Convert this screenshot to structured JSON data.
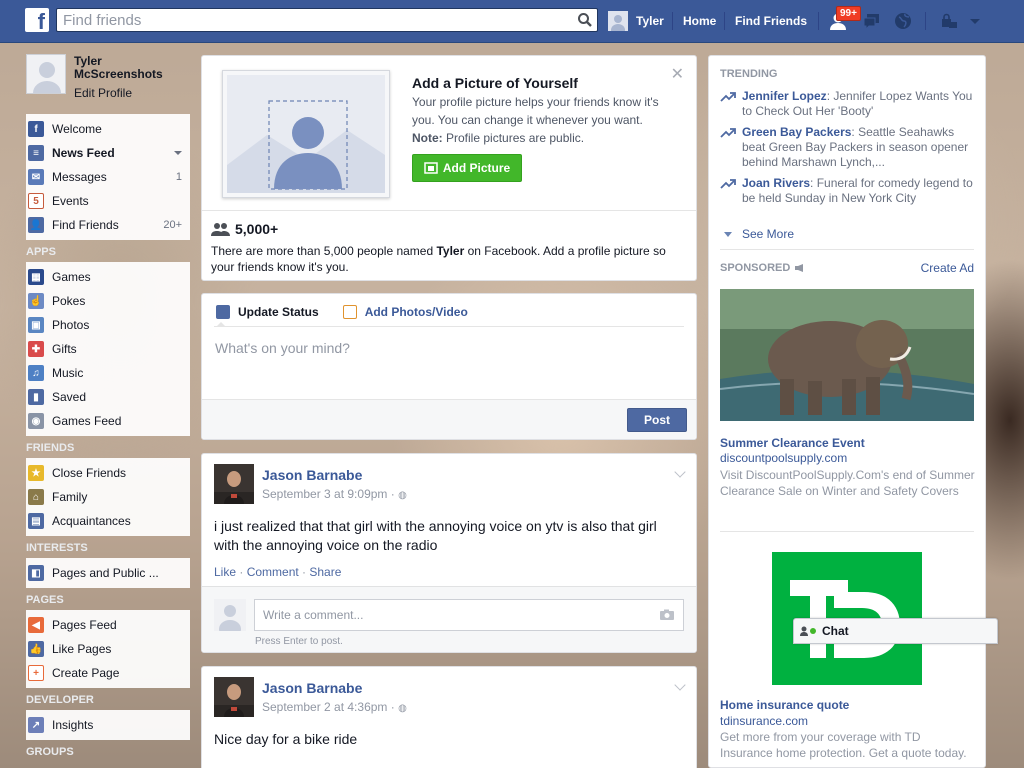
{
  "topbar": {
    "search_placeholder": "Find friends",
    "user_name": "Tyler",
    "home": "Home",
    "find_friends": "Find Friends",
    "friend_requests_badge": "99+",
    "icons": [
      "friend-requests-icon",
      "messages-icon",
      "notifications-globe-icon",
      "privacy-icon",
      "account-menu-icon"
    ]
  },
  "profile": {
    "name": "Tyler McScreenshots",
    "edit": "Edit Profile"
  },
  "nav": {
    "main": [
      {
        "label": "Welcome",
        "count": "",
        "icon": "facebook-icon",
        "color": "#3b5998"
      },
      {
        "label": "News Feed",
        "count": "",
        "icon": "news-feed-icon",
        "color": "#4e69a2"
      },
      {
        "label": "Messages",
        "count": "1",
        "icon": "messages-icon",
        "color": "#5a7ab8"
      },
      {
        "label": "Events",
        "count": "",
        "icon": "events-icon",
        "color": "#c65b3d"
      },
      {
        "label": "Find Friends",
        "count": "20+",
        "icon": "find-friends-icon",
        "color": "#4e69a2"
      }
    ],
    "apps_header": "APPS",
    "apps": [
      {
        "label": "Games",
        "icon": "games-icon",
        "color": "#2b4a8c"
      },
      {
        "label": "Pokes",
        "icon": "pokes-icon",
        "color": "#6d8ac4"
      },
      {
        "label": "Photos",
        "icon": "photos-icon",
        "color": "#5a86c2"
      },
      {
        "label": "Gifts",
        "icon": "gifts-icon",
        "color": "#d94b4b"
      },
      {
        "label": "Music",
        "icon": "music-icon",
        "color": "#4e80c4"
      },
      {
        "label": "Saved",
        "icon": "saved-icon",
        "color": "#4e69a2"
      },
      {
        "label": "Games Feed",
        "icon": "games-feed-icon",
        "color": "#8a94a6"
      }
    ],
    "friends_header": "FRIENDS",
    "friends": [
      {
        "label": "Close Friends",
        "icon": "close-friends-icon",
        "color": "#e8b92b"
      },
      {
        "label": "Family",
        "icon": "family-icon",
        "color": "#8a7a4a"
      },
      {
        "label": "Acquaintances",
        "icon": "acquaintances-icon",
        "color": "#4e69a2"
      }
    ],
    "interests_header": "INTERESTS",
    "interests": [
      {
        "label": "Pages and Public ...",
        "icon": "pages-public-icon",
        "color": "#4e69a2"
      }
    ],
    "pages_header": "PAGES",
    "pages": [
      {
        "label": "Pages Feed",
        "icon": "pages-feed-icon",
        "color": "#e86a3a"
      },
      {
        "label": "Like Pages",
        "icon": "like-pages-icon",
        "color": "#4e69a2"
      },
      {
        "label": "Create Page",
        "icon": "create-page-icon",
        "color": "#e86a3a"
      }
    ],
    "developer_header": "DEVELOPER",
    "developer": [
      {
        "label": "Insights",
        "icon": "insights-icon",
        "color": "#6d7fb8"
      }
    ],
    "groups_header": "GROUPS"
  },
  "profile_prompt": {
    "title": "Add a Picture of Yourself",
    "text": "Your profile picture helps your friends know it's you. You can change it whenever you want.",
    "note_label": "Note:",
    "note_text": " Profile pictures are public.",
    "button": "Add Picture",
    "count": "5,000+",
    "names_pre": "There are more than 5,000 people named ",
    "names_bold": "Tyler",
    "names_post": " on Facebook. Add a profile picture so your friends know it's you."
  },
  "composer": {
    "tab_status": "Update Status",
    "tab_photos": "Add Photos/Video",
    "placeholder": "What's on your mind?",
    "post": "Post"
  },
  "stories": [
    {
      "author": "Jason Barnabe",
      "time": "September 3 at 9:09pm ·",
      "text": "i just realized that that girl with the annoying voice on ytv is also that girl with the annoying voice on the radio",
      "like": "Like",
      "comment": "Comment",
      "share": "Share",
      "comment_placeholder": "Write a comment...",
      "hint": "Press Enter to post."
    },
    {
      "author": "Jason Barnabe",
      "time": "September 2 at 4:36pm ·",
      "text": "Nice day for a bike ride"
    }
  ],
  "right": {
    "trending_header": "TRENDING",
    "trends": [
      {
        "topic": "Jennifer Lopez",
        "text": ": Jennifer Lopez Wants You to Check Out Her 'Booty'"
      },
      {
        "topic": "Green Bay Packers",
        "text": ": Seattle Seahawks beat Green Bay Packers in season opener behind Marshawn Lynch,..."
      },
      {
        "topic": "Joan Rivers",
        "text": ": Funeral for comedy legend to be held Sunday in New York City"
      }
    ],
    "see_more": "See More",
    "sponsored_header": "SPONSORED",
    "create_ad": "Create Ad",
    "ads": [
      {
        "title": "Summer Clearance Event",
        "domain": "discountpoolsupply.com",
        "desc": "Visit DiscountPoolSupply.Com's end of Summer Clearance Sale on Winter and Safety Covers"
      },
      {
        "title": "Home insurance quote",
        "domain": "tdinsurance.com",
        "desc": "Get more from your coverage with TD Insurance home protection. Get a quote today."
      }
    ],
    "td_logo": "TD"
  },
  "chat": {
    "label": "Chat"
  }
}
